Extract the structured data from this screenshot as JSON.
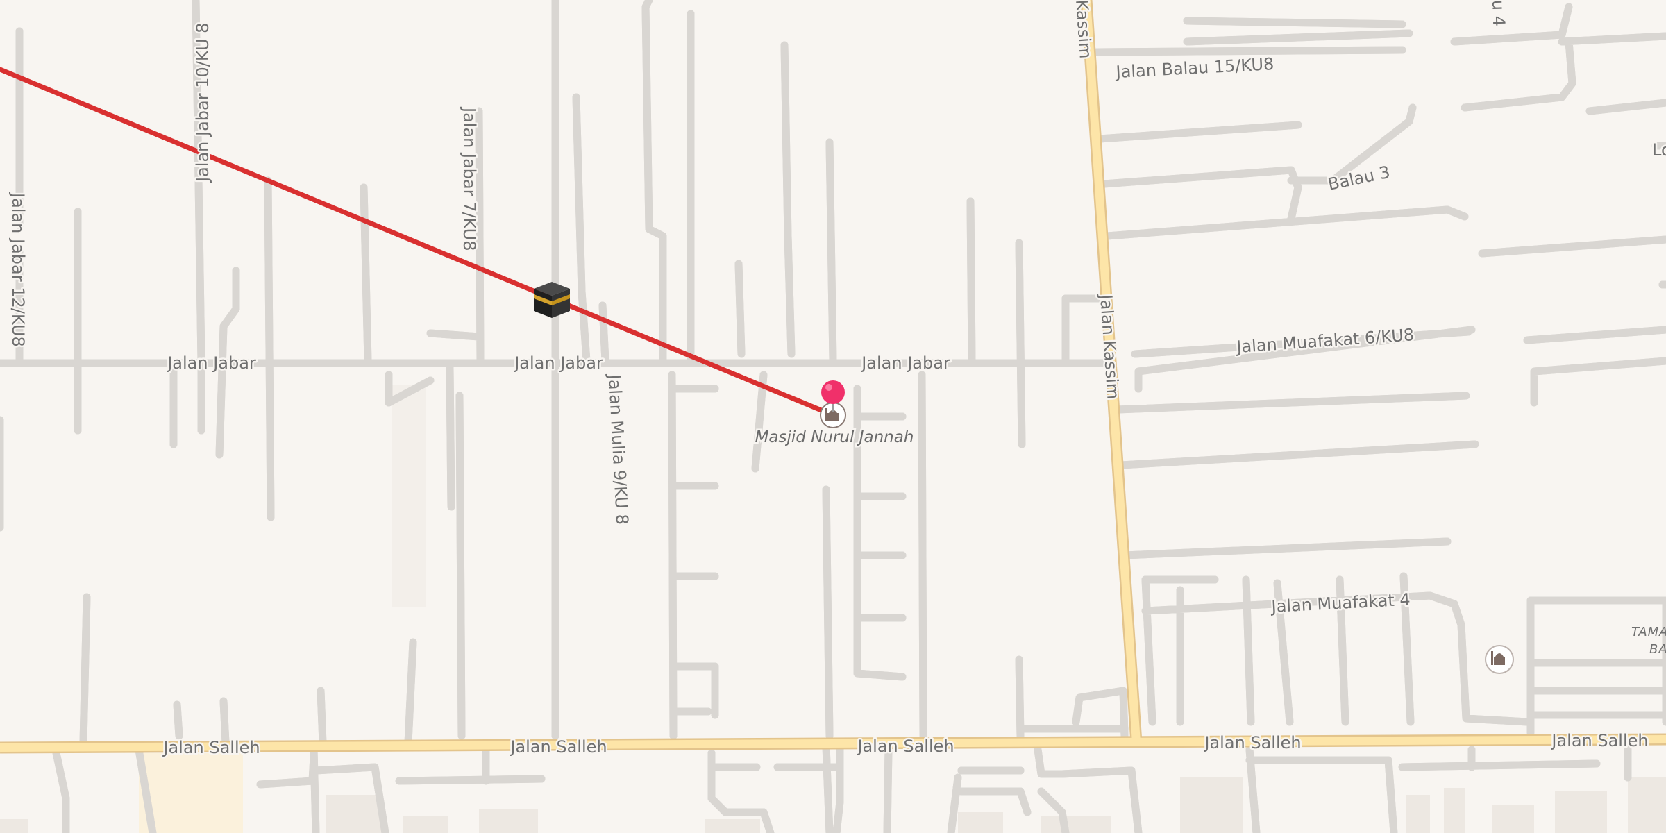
{
  "map": {
    "road_labels": {
      "jalan_jabar_12": "Jalan Jabar 12/KU8",
      "jalan_jabar_10": "Jalan Jabar 10/KU 8",
      "jalan_jabar_7": "Jalan Jabar 7/KU8",
      "jalan_jabar": "Jalan Jabar",
      "jalan_mulia_9": "Jalan Mulia 9/KU 8",
      "jalan_kassim": "Jalan Kassim",
      "kassim_top": "Kassim",
      "jalan_balau_15": "Jalan Balau 15/KU8",
      "balau_3": "Balau 3",
      "jalan_muafakat_6": "Jalan Muafakat 6/KU8",
      "jalan_muafakat_4": "Jalan Muafakat 4",
      "jalan_salleh": "Jalan Salleh",
      "top_right_partial": "u 4",
      "right_edge_partial": "Lo"
    },
    "pois": {
      "mosque_name": "Masjid Nurul Jannah",
      "area_label_line1": "TAMA",
      "area_label_line2": "BA"
    },
    "icons": {
      "kaaba": "kaaba-icon",
      "pin": "location-pin-icon",
      "mosque": "mosque-icon"
    },
    "colors": {
      "background": "#f8f5f1",
      "minor_road": "#ffffff",
      "major_road": "#fde5a8",
      "qibla_line": "#d93030",
      "pin": "#f0306a"
    }
  }
}
